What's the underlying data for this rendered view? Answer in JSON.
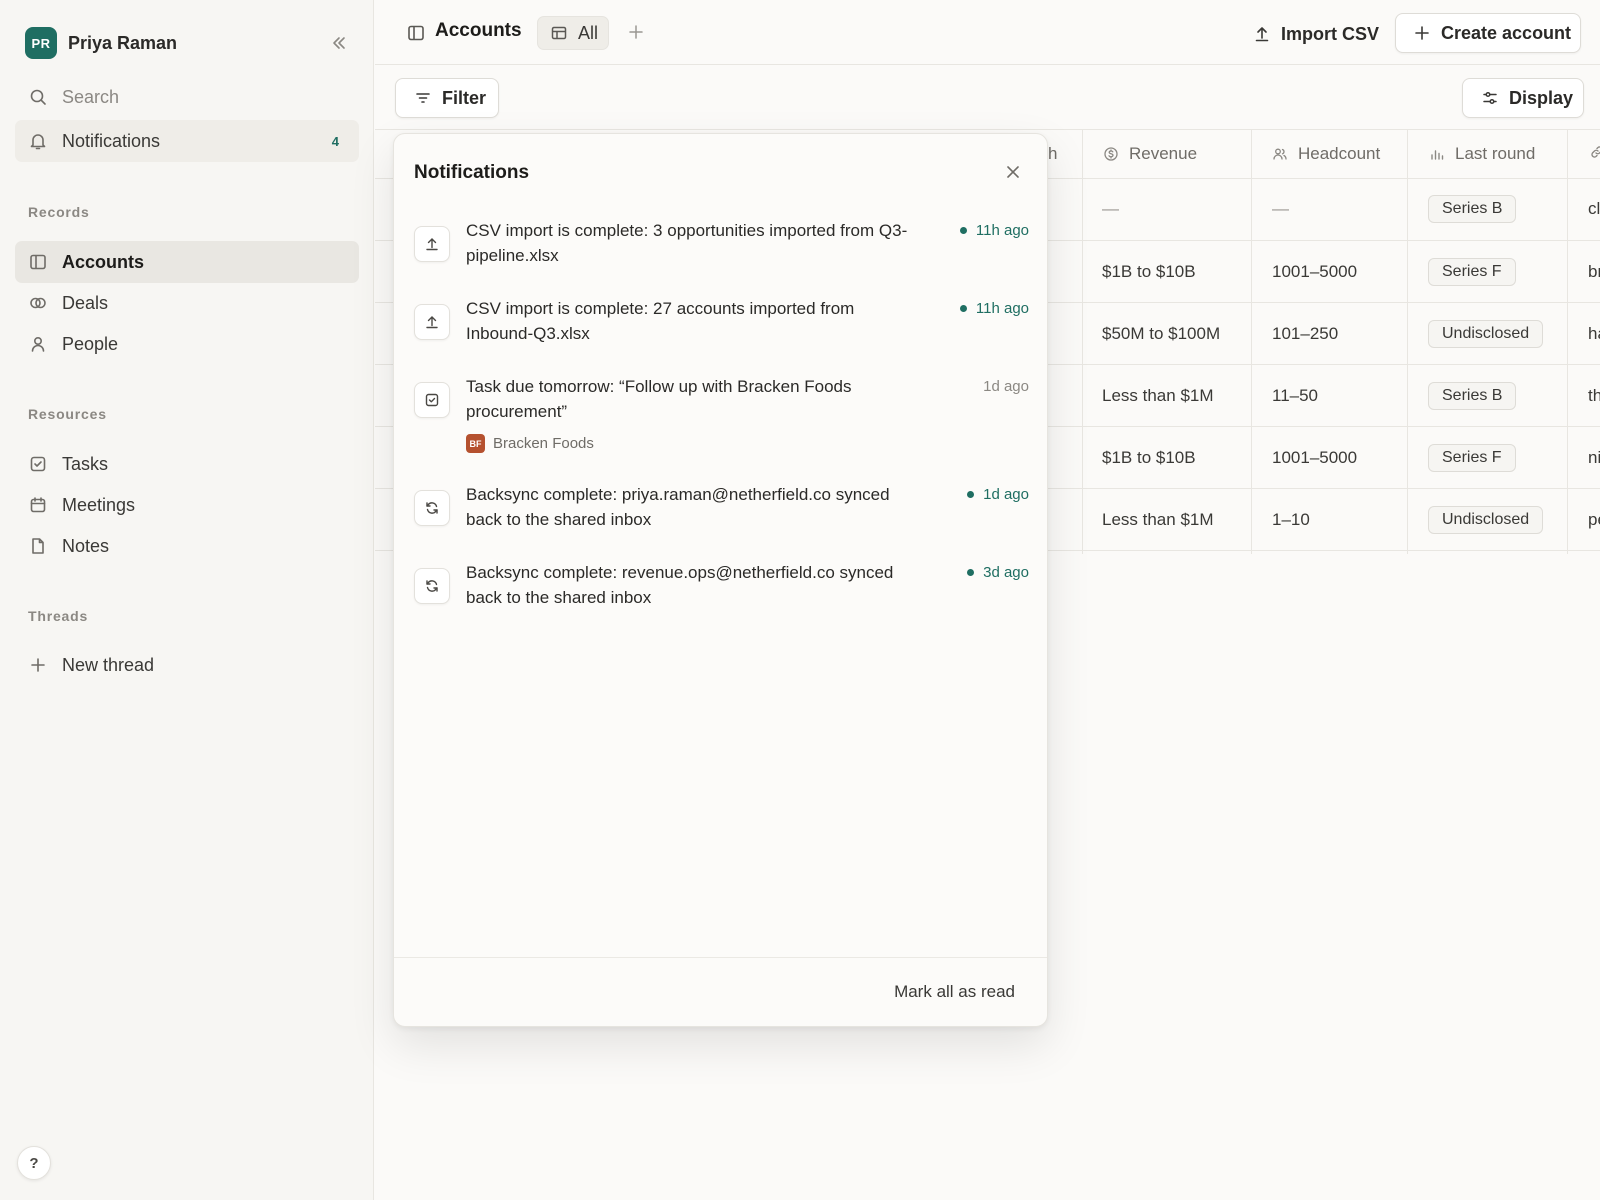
{
  "sidebar": {
    "user": {
      "initials": "PR",
      "name": "Priya Raman"
    },
    "search_label": "Search",
    "notifications": {
      "label": "Notifications",
      "count": "4"
    },
    "sections": {
      "records": "Records",
      "resources": "Resources",
      "threads": "Threads"
    },
    "records": [
      {
        "label": "Accounts",
        "icon": "panel-icon",
        "active": true
      },
      {
        "label": "Deals",
        "icon": "rings-icon"
      },
      {
        "label": "People",
        "icon": "person-icon"
      }
    ],
    "resources": [
      {
        "label": "Tasks",
        "icon": "checkbox-icon"
      },
      {
        "label": "Meetings",
        "icon": "calendar-icon"
      },
      {
        "label": "Notes",
        "icon": "document-icon"
      }
    ],
    "new_thread": "New thread",
    "help": "?"
  },
  "topbar": {
    "title": "Accounts",
    "view_label": "All",
    "import_label": "Import CSV",
    "create_label": "Create account"
  },
  "toolbar": {
    "filter_label": "Filter",
    "display_label": "Display"
  },
  "table": {
    "hidden_header_stub": "h",
    "columns": [
      {
        "label": "Revenue",
        "icon": "dollar-circle-icon"
      },
      {
        "label": "Headcount",
        "icon": "people-icon"
      },
      {
        "label": "Last round",
        "icon": "bar-chart-icon"
      },
      {
        "label": "",
        "icon": "link-icon"
      }
    ],
    "rows": [
      {
        "revenue": "—",
        "headcount": "—",
        "last_round": "Series B",
        "domain": "cl"
      },
      {
        "revenue": "$1B to $10B",
        "headcount": "1001–5000",
        "last_round": "Series F",
        "domain": "br"
      },
      {
        "revenue": "$50M to $100M",
        "headcount": "101–250",
        "last_round": "Undisclosed",
        "domain": "ha"
      },
      {
        "revenue": "Less than $1M",
        "headcount": "11–50",
        "last_round": "Series B",
        "domain": "th"
      },
      {
        "revenue": "$1B to $10B",
        "headcount": "1001–5000",
        "last_round": "Series F",
        "domain": "ni"
      },
      {
        "revenue": "Less than $1M",
        "headcount": "1–10",
        "last_round": "Undisclosed",
        "domain": "pe"
      }
    ]
  },
  "notifications_panel": {
    "title": "Notifications",
    "items": [
      {
        "icon": "upload-icon",
        "text": "CSV import is complete: 3 opportunities imported from Q3-pipeline.xlsx",
        "time": "11h ago",
        "unread": true
      },
      {
        "icon": "upload-icon",
        "text": "CSV import is complete: 27 accounts imported from Inbound-Q3.xlsx",
        "time": "11h ago",
        "unread": true
      },
      {
        "icon": "checkbox-icon",
        "text": "Task due tomorrow: “Follow up with Bracken Foods procurement”",
        "time": "1d ago",
        "unread": false,
        "meta": {
          "badge": "BF",
          "label": "Bracken Foods"
        }
      },
      {
        "icon": "sync-icon",
        "text": "Backsync complete: priya.raman@netherfield.co synced back to the shared inbox",
        "time": "1d ago",
        "unread": true
      },
      {
        "icon": "sync-icon",
        "text": "Backsync complete: revenue.ops@netherfield.co synced back to the shared inbox",
        "time": "3d ago",
        "unread": true
      }
    ],
    "mark_all_label": "Mark all as read"
  },
  "colors": {
    "accent": "#1f6e62",
    "badge_bracken": "#b5512f",
    "background": "#fbfaf8",
    "sidebar_bg": "#f7f6f3"
  }
}
